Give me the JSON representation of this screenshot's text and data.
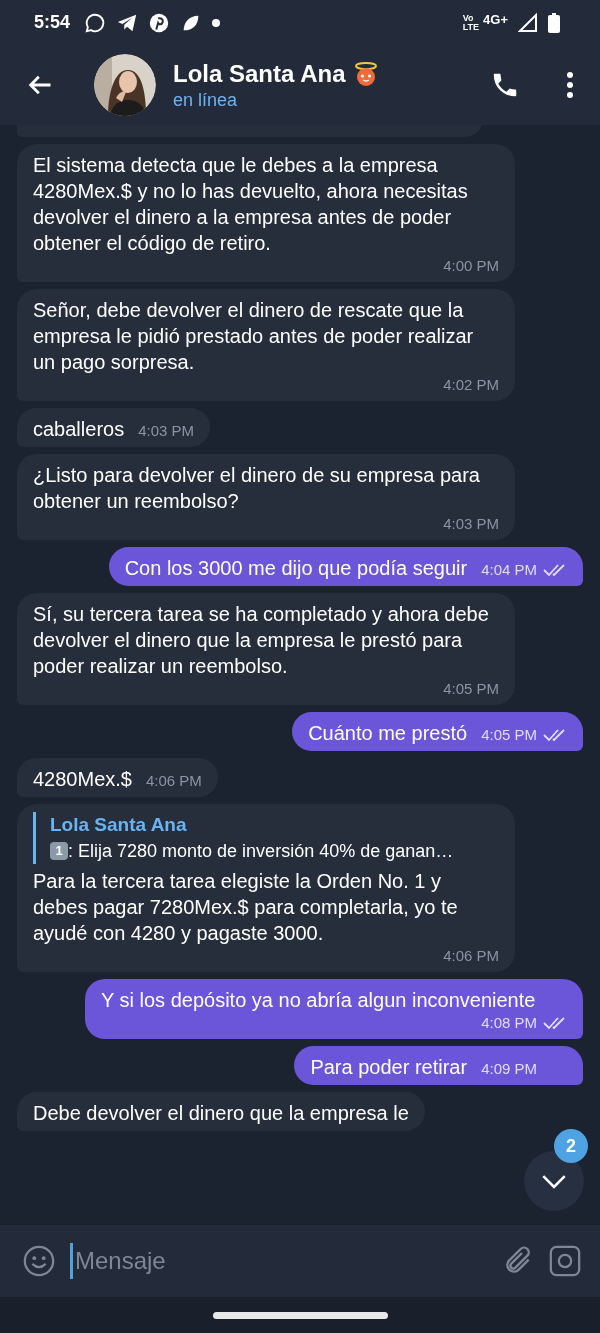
{
  "status_bar": {
    "time": "5:54",
    "volte_top": "Vo",
    "volte_bottom": "LTE",
    "network": "4G+"
  },
  "header": {
    "name": "Lola Santa Ana",
    "status": "en línea"
  },
  "messages": [
    {
      "kind": "stub"
    },
    {
      "kind": "incoming",
      "text": "El sistema detecta que le debes a la empresa 4280Mex.$ y no lo has devuelto, ahora necesitas devolver el dinero a la empresa antes de poder obtener el código de retiro.",
      "time": "4:00 PM"
    },
    {
      "kind": "incoming",
      "text": "Señor, debe devolver el dinero de rescate que la empresa le pidió prestado antes de poder realizar un pago sorpresa.",
      "time": "4:02 PM"
    },
    {
      "kind": "incoming",
      "text": "caballeros",
      "time": "4:03 PM"
    },
    {
      "kind": "incoming",
      "text": "¿Listo para devolver el dinero de su empresa para obtener un reembolso?",
      "time": "4:03 PM"
    },
    {
      "kind": "outgoing",
      "text": "Con los 3000 me dijo que podía seguir",
      "time": "4:04 PM",
      "read": true
    },
    {
      "kind": "incoming",
      "text": "Sí, su tercera tarea se ha completado y ahora debe devolver el dinero que la empresa le prestó para poder realizar un reembolso.",
      "time": "4:05 PM"
    },
    {
      "kind": "outgoing",
      "text": "Cuánto me prestó",
      "time": "4:05 PM",
      "read": true
    },
    {
      "kind": "incoming",
      "text": "4280Mex.$",
      "time": "4:06 PM"
    },
    {
      "kind": "incoming",
      "reply": {
        "author": "Lola Santa Ana",
        "badge": "1",
        "text": ": Elija 7280  monto de inversión 40% de ganan…"
      },
      "text": "Para la tercera tarea elegiste la Orden No. 1 y debes pagar 7280Mex.$ para completarla, yo te ayudé con 4280 y pagaste 3000.",
      "time": "4:06 PM"
    },
    {
      "kind": "outgoing",
      "text": "Y si los depósito ya no abría algun inconveniente",
      "time": "4:08 PM",
      "read": true
    },
    {
      "kind": "outgoing",
      "text": "Para poder retirar",
      "time": "4:09 PM"
    },
    {
      "kind": "incoming",
      "text": "Debe devolver el dinero que la empresa le"
    }
  ],
  "scroll_button": {
    "badge": "2"
  },
  "composer": {
    "placeholder": "Mensaje"
  }
}
